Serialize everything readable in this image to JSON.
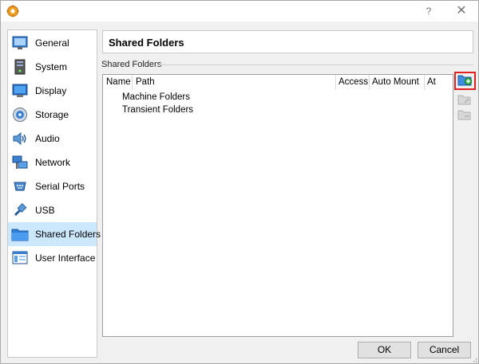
{
  "window": {
    "help_glyph": "?",
    "close_glyph": "✕"
  },
  "sidebar": {
    "items": [
      {
        "label": "General",
        "icon": "general-icon"
      },
      {
        "label": "System",
        "icon": "system-icon"
      },
      {
        "label": "Display",
        "icon": "display-icon"
      },
      {
        "label": "Storage",
        "icon": "storage-icon"
      },
      {
        "label": "Audio",
        "icon": "audio-icon"
      },
      {
        "label": "Network",
        "icon": "network-icon"
      },
      {
        "label": "Serial Ports",
        "icon": "serial-ports-icon"
      },
      {
        "label": "USB",
        "icon": "usb-icon"
      },
      {
        "label": "Shared Folders",
        "icon": "shared-folders-icon",
        "selected": true
      },
      {
        "label": "User Interface",
        "icon": "user-interface-icon"
      }
    ]
  },
  "page": {
    "title": "Shared Folders",
    "group_label": "Shared Folders"
  },
  "table": {
    "columns": [
      "Name",
      "Path",
      "Access",
      "Auto Mount",
      "At"
    ],
    "rows": [
      "Machine Folders",
      "Transient Folders"
    ]
  },
  "toolbar": {
    "buttons": [
      {
        "icon": "add-shared-folder-icon",
        "enabled": true,
        "highlighted": true
      },
      {
        "icon": "edit-shared-folder-icon",
        "enabled": false
      },
      {
        "icon": "remove-shared-folder-icon",
        "enabled": false
      }
    ]
  },
  "buttons": {
    "ok": "OK",
    "cancel": "Cancel"
  },
  "colors": {
    "selection": "#cce8ff",
    "highlight_border": "#e02020",
    "accent": "#2b7cd3"
  }
}
